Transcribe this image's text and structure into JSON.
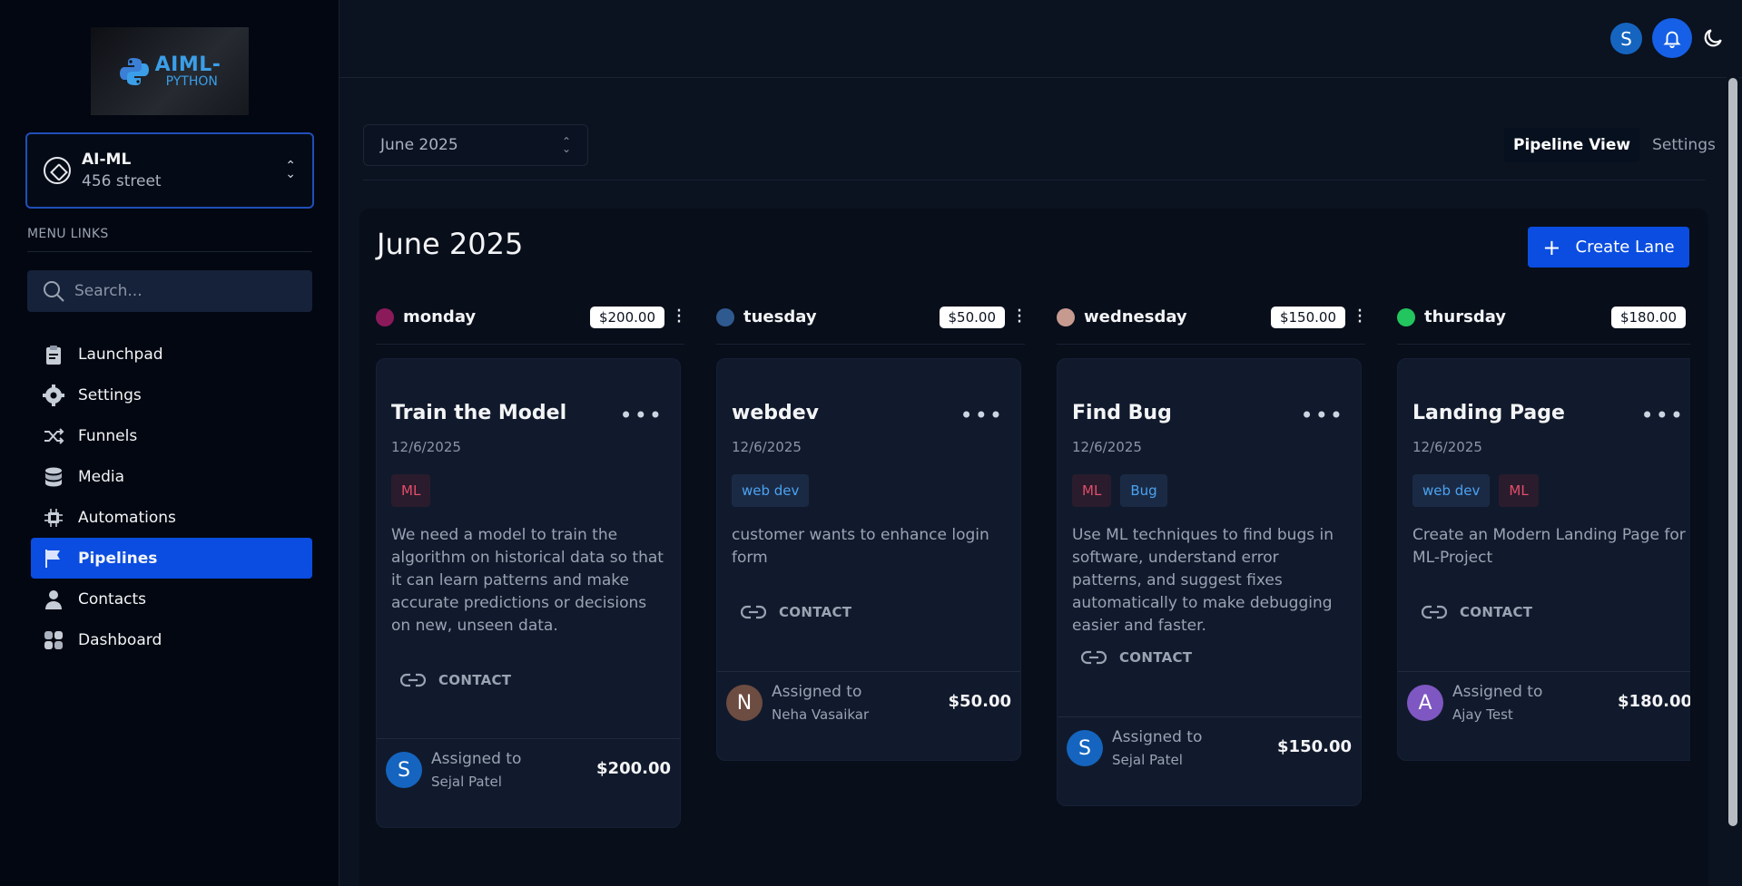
{
  "brand": {
    "logo_line1": "AIML-",
    "logo_line2": "PYTHON"
  },
  "account": {
    "name": "AI-ML",
    "address": "456 street"
  },
  "menu": {
    "title": "MENU LINKS",
    "search_placeholder": "Search...",
    "items": [
      {
        "label": "Launchpad",
        "icon": "clipboard-icon"
      },
      {
        "label": "Settings",
        "icon": "gear-icon"
      },
      {
        "label": "Funnels",
        "icon": "shuffle-icon"
      },
      {
        "label": "Media",
        "icon": "database-icon"
      },
      {
        "label": "Automations",
        "icon": "chip-icon"
      },
      {
        "label": "Pipelines",
        "icon": "flag-icon",
        "active": true
      },
      {
        "label": "Contacts",
        "icon": "person-icon"
      },
      {
        "label": "Dashboard",
        "icon": "grid-icon"
      }
    ]
  },
  "topbar": {
    "user_initial": "S"
  },
  "filters": {
    "month": "June 2025",
    "tabs": [
      "Pipeline View",
      "Settings"
    ]
  },
  "board": {
    "title": "June 2025",
    "create_label": "Create Lane",
    "lanes": [
      {
        "name": "monday",
        "amount": "$200.00",
        "color": "#8b1a5a",
        "card": {
          "title": "Train the Model",
          "date": "12/6/2025",
          "tags": [
            {
              "label": "ML",
              "kind": "ml"
            }
          ],
          "description": "We need a model to train the algorithm on historical data so that it can learn patterns and make accurate predictions or decisions on new, unseen data.",
          "contact_label": "CONTACT",
          "assigned_label": "Assigned to",
          "assignee": "Sejal Patel",
          "assignee_initial": "S",
          "avatar_color": "#1565c0",
          "value": "$200.00"
        }
      },
      {
        "name": "tuesday",
        "amount": "$50.00",
        "color": "#2f5a8f",
        "card": {
          "title": "webdev",
          "date": "12/6/2025",
          "tags": [
            {
              "label": "web dev",
              "kind": "web"
            }
          ],
          "description": "customer wants to enhance login form",
          "contact_label": "CONTACT",
          "assigned_label": "Assigned to",
          "assignee": "Neha Vasaikar",
          "assignee_initial": "N",
          "avatar_color": "#6d4c41",
          "value": "$50.00"
        }
      },
      {
        "name": "wednesday",
        "amount": "$150.00",
        "color": "#c79a90",
        "card": {
          "title": "Find Bug",
          "date": "12/6/2025",
          "tags": [
            {
              "label": "ML",
              "kind": "ml"
            },
            {
              "label": "Bug",
              "kind": "web"
            }
          ],
          "description": "Use ML techniques to find bugs in software, understand error patterns, and suggest fixes automatically to make debugging easier and faster.",
          "contact_label": "CONTACT",
          "assigned_label": "Assigned to",
          "assignee": "Sejal Patel",
          "assignee_initial": "S",
          "avatar_color": "#1565c0",
          "value": "$150.00"
        }
      },
      {
        "name": "thursday",
        "amount": "$180.00",
        "color": "#22c55e",
        "card": {
          "title": "Landing Page",
          "date": "12/6/2025",
          "tags": [
            {
              "label": "web dev",
              "kind": "web"
            },
            {
              "label": "ML",
              "kind": "ml"
            }
          ],
          "description": "Create an Modern Landing Page for ML-Project",
          "contact_label": "CONTACT",
          "assigned_label": "Assigned to",
          "assignee": "Ajay Test",
          "assignee_initial": "A",
          "avatar_color": "#7e57c2",
          "value": "$180.00"
        }
      }
    ]
  }
}
